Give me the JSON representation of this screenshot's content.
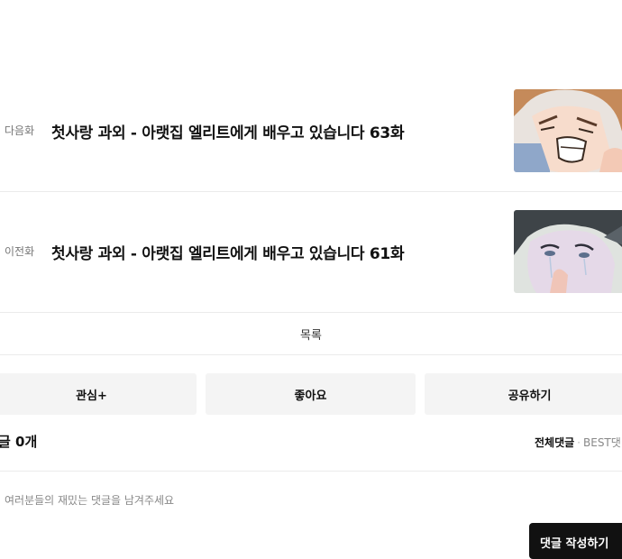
{
  "next_episode": {
    "label": "다음화",
    "title": "첫사랑 과외 - 아랫집 엘리트에게 배우고 있습니다 63화"
  },
  "prev_episode": {
    "label": "이전화",
    "title": "첫사랑 과외 - 아랫집 엘리트에게 배우고 있습니다 61화"
  },
  "list_label": "목록",
  "actions": {
    "favorite_label": "관심+",
    "like_label": "좋아요",
    "share_label": "공유하기"
  },
  "comments": {
    "count_label": "글 0개",
    "tab_all": "전체댓글",
    "tab_separator": "·",
    "tab_best": "BEST댓",
    "input_placeholder": "여러분들의 재밌는 댓글을 남겨주세요",
    "submit_label": "댓글 작성하기"
  }
}
